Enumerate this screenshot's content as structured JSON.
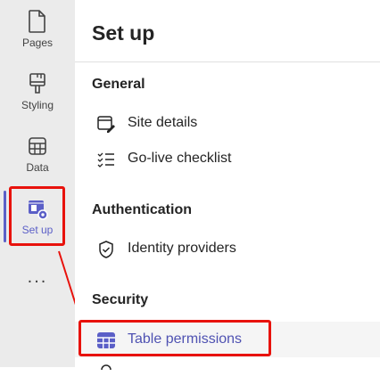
{
  "rail": {
    "items": [
      {
        "label": "Pages",
        "icon": "pages-icon"
      },
      {
        "label": "Styling",
        "icon": "styling-icon"
      },
      {
        "label": "Data",
        "icon": "data-icon"
      },
      {
        "label": "Set up",
        "icon": "setup-icon"
      }
    ],
    "more_label": "...",
    "active_color": "#5b5fc7"
  },
  "panel": {
    "title": "Set up",
    "sections": [
      {
        "heading": "General",
        "items": [
          {
            "label": "Site details",
            "icon": "site-details-icon"
          },
          {
            "label": "Go-live checklist",
            "icon": "checklist-icon"
          }
        ]
      },
      {
        "heading": "Authentication",
        "items": [
          {
            "label": "Identity providers",
            "icon": "shield-check-icon"
          }
        ]
      },
      {
        "heading": "Security",
        "items": [
          {
            "label": "Table permissions",
            "icon": "table-permissions-icon",
            "selected": true
          }
        ]
      }
    ]
  },
  "annotation_color": "#e8120c"
}
